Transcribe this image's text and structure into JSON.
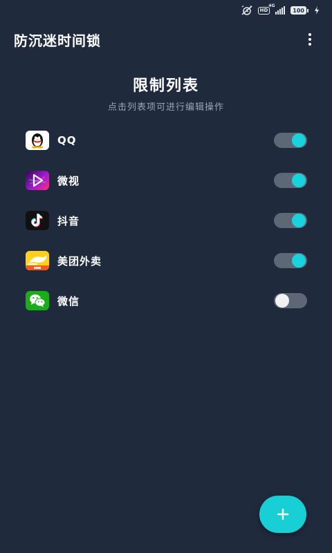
{
  "status_bar": {
    "hd_label": "HD",
    "network_label": "4G",
    "battery_level": "100"
  },
  "app_bar": {
    "title": "防沉迷时间锁"
  },
  "main": {
    "heading": "限制列表",
    "subheading": "点击列表项可进行编辑操作"
  },
  "apps": [
    {
      "label": "QQ",
      "icon": "qq-icon",
      "enabled": true
    },
    {
      "label": "微视",
      "icon": "weishi-icon",
      "enabled": true
    },
    {
      "label": "抖音",
      "icon": "douyin-icon",
      "enabled": true
    },
    {
      "label": "美团外卖",
      "icon": "meituan-waimai-icon",
      "enabled": true
    },
    {
      "label": "微信",
      "icon": "wechat-icon",
      "enabled": false
    }
  ],
  "fab": {
    "icon": "plus-icon"
  },
  "colors": {
    "background": "#1f2a3d",
    "accent": "#19d3dc",
    "toggle_track": "#5e6776",
    "subtext": "#9aa4b4"
  }
}
